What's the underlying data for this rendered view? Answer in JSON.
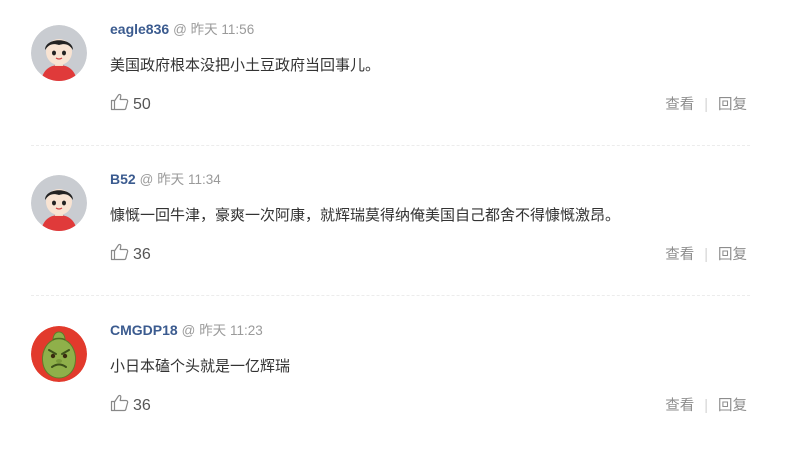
{
  "comments": [
    {
      "username": "eagle836",
      "at": "@",
      "time": "昨天 11:56",
      "text": "美国政府根本没把小土豆政府当回事儿。",
      "likes": "50",
      "view_label": "查看",
      "separator": "|",
      "reply_label": "回复",
      "avatar": "cartoon-boy-avatar"
    },
    {
      "username": "B52",
      "at": "@",
      "time": "昨天 11:34",
      "text": "慷慨一回牛津，豪爽一次阿康，就辉瑞莫得纳俺美国自己都舍不得慷慨激昂。",
      "likes": "36",
      "view_label": "查看",
      "separator": "|",
      "reply_label": "回复",
      "avatar": "cartoon-boy-avatar"
    },
    {
      "username": "CMGDP18",
      "at": "@",
      "time": "昨天 11:23",
      "text": "小日本磕个头就是一亿辉瑞",
      "likes": "36",
      "view_label": "查看",
      "separator": "|",
      "reply_label": "回复",
      "avatar": "green-squash-avatar"
    }
  ],
  "colors": {
    "username": "#3b5b8f",
    "meta": "#9a9a9a",
    "text": "#333333",
    "action": "#8d8d8d"
  },
  "icons": {
    "like": "thumbs-up-icon"
  }
}
